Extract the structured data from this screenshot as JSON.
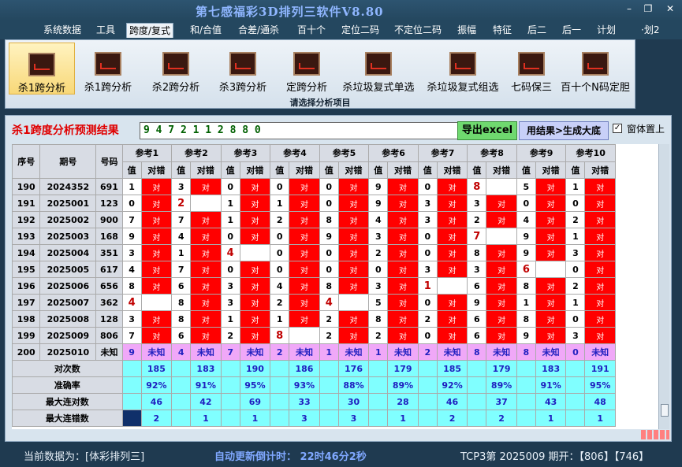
{
  "app": {
    "title": "第七感福彩3D排列三软件V8.80",
    "min_btn": "–",
    "max_btn": "❐",
    "close_btn": "✕"
  },
  "menu": [
    {
      "label": "系统数据"
    },
    {
      "label": "工具"
    },
    {
      "label": "跨度/复式",
      "active": true
    },
    {
      "label": "和/合值"
    },
    {
      "label": "合差/通杀"
    },
    {
      "label": "百十个"
    },
    {
      "label": "定位二码"
    },
    {
      "label": "不定位二码"
    },
    {
      "label": "振幅"
    },
    {
      "label": "特征"
    },
    {
      "label": "后二"
    },
    {
      "label": "后一"
    },
    {
      "label": "计划"
    },
    {
      "label": "·划2"
    }
  ],
  "ribbon": {
    "buttons": [
      {
        "label": "杀1跨分析",
        "selected": true,
        "icon": "analysis-chart-icon"
      },
      {
        "label": "杀1跨分析",
        "icon": "analysis-chart-icon"
      },
      {
        "label": "杀2跨分析",
        "icon": "analysis-chart-icon"
      },
      {
        "label": "杀3跨分析",
        "icon": "analysis-chart-icon"
      },
      {
        "label": "定跨分析",
        "icon": "analysis-chart-icon"
      },
      {
        "label": "杀垃圾复式单选",
        "icon": "analysis-chart-icon"
      },
      {
        "label": "杀垃圾复式组选",
        "icon": "analysis-chart-icon"
      },
      {
        "label": "七码保三",
        "icon": "analysis-chart-icon"
      },
      {
        "label": "百十个N码定胆",
        "icon": "analysis-chart-icon"
      }
    ],
    "caption": "请选择分析项目"
  },
  "result": {
    "title": "杀1跨度分析预测结果",
    "value": "9 4 7 2 1 1 2 8 8 0",
    "export_label": "导出excel",
    "generate_label": "用结果>生成大底",
    "ontop_label": "窗体置上",
    "ontop_checked": "✓"
  },
  "table": {
    "headers": {
      "seq": "序号",
      "issue": "期号",
      "code": "号码",
      "val": "值",
      "ok": "对错"
    },
    "refs": [
      "参考1",
      "参考2",
      "参考3",
      "参考4",
      "参考5",
      "参考6",
      "参考7",
      "参考8",
      "参考9",
      "参考10"
    ],
    "right_mark": "对",
    "unknown": "未知",
    "rows": [
      {
        "seq": "190",
        "issue": "2024352",
        "code": "691",
        "cells": [
          [
            "1",
            1
          ],
          [
            "3",
            1
          ],
          [
            "0",
            1
          ],
          [
            "0",
            1
          ],
          [
            "0",
            1
          ],
          [
            "9",
            1
          ],
          [
            "0",
            1
          ],
          [
            "8",
            0
          ],
          [
            "5",
            1
          ],
          [
            "1",
            1
          ]
        ]
      },
      {
        "seq": "191",
        "issue": "2025001",
        "code": "123",
        "cells": [
          [
            "0",
            1
          ],
          [
            "2",
            0
          ],
          [
            "1",
            1
          ],
          [
            "1",
            1
          ],
          [
            "0",
            1
          ],
          [
            "9",
            1
          ],
          [
            "3",
            1
          ],
          [
            "3",
            1
          ],
          [
            "0",
            1
          ],
          [
            "0",
            1
          ]
        ]
      },
      {
        "seq": "192",
        "issue": "2025002",
        "code": "900",
        "cells": [
          [
            "7",
            1
          ],
          [
            "7",
            1
          ],
          [
            "1",
            1
          ],
          [
            "2",
            1
          ],
          [
            "8",
            1
          ],
          [
            "4",
            1
          ],
          [
            "3",
            1
          ],
          [
            "2",
            1
          ],
          [
            "4",
            1
          ],
          [
            "2",
            1
          ]
        ]
      },
      {
        "seq": "193",
        "issue": "2025003",
        "code": "168",
        "cells": [
          [
            "9",
            1
          ],
          [
            "4",
            1
          ],
          [
            "0",
            1
          ],
          [
            "0",
            1
          ],
          [
            "9",
            1
          ],
          [
            "3",
            1
          ],
          [
            "0",
            1
          ],
          [
            "7",
            0
          ],
          [
            "9",
            1
          ],
          [
            "1",
            1
          ]
        ]
      },
      {
        "seq": "194",
        "issue": "2025004",
        "code": "351",
        "cells": [
          [
            "3",
            1
          ],
          [
            "1",
            1
          ],
          [
            "4",
            0
          ],
          [
            "0",
            1
          ],
          [
            "0",
            1
          ],
          [
            "2",
            1
          ],
          [
            "0",
            1
          ],
          [
            "8",
            1
          ],
          [
            "9",
            1
          ],
          [
            "3",
            1
          ]
        ]
      },
      {
        "seq": "195",
        "issue": "2025005",
        "code": "617",
        "cells": [
          [
            "4",
            1
          ],
          [
            "7",
            1
          ],
          [
            "0",
            1
          ],
          [
            "0",
            1
          ],
          [
            "0",
            1
          ],
          [
            "0",
            1
          ],
          [
            "3",
            1
          ],
          [
            "3",
            1
          ],
          [
            "6",
            0
          ],
          [
            "0",
            1
          ]
        ]
      },
      {
        "seq": "196",
        "issue": "2025006",
        "code": "656",
        "cells": [
          [
            "8",
            1
          ],
          [
            "6",
            1
          ],
          [
            "3",
            1
          ],
          [
            "4",
            1
          ],
          [
            "8",
            1
          ],
          [
            "3",
            1
          ],
          [
            "1",
            0
          ],
          [
            "6",
            1
          ],
          [
            "8",
            1
          ],
          [
            "2",
            1
          ]
        ]
      },
      {
        "seq": "197",
        "issue": "2025007",
        "code": "362",
        "cells": [
          [
            "4",
            0
          ],
          [
            "8",
            1
          ],
          [
            "3",
            1
          ],
          [
            "2",
            1
          ],
          [
            "4",
            0
          ],
          [
            "5",
            1
          ],
          [
            "0",
            1
          ],
          [
            "9",
            1
          ],
          [
            "1",
            1
          ],
          [
            "1",
            1
          ]
        ]
      },
      {
        "seq": "198",
        "issue": "2025008",
        "code": "128",
        "cells": [
          [
            "3",
            1
          ],
          [
            "8",
            1
          ],
          [
            "1",
            1
          ],
          [
            "1",
            1
          ],
          [
            "2",
            1
          ],
          [
            "8",
            1
          ],
          [
            "2",
            1
          ],
          [
            "6",
            1
          ],
          [
            "8",
            1
          ],
          [
            "0",
            1
          ]
        ]
      },
      {
        "seq": "199",
        "issue": "2025009",
        "code": "806",
        "cells": [
          [
            "7",
            1
          ],
          [
            "6",
            1
          ],
          [
            "2",
            1
          ],
          [
            "8",
            0
          ],
          [
            "2",
            1
          ],
          [
            "2",
            1
          ],
          [
            "0",
            1
          ],
          [
            "6",
            1
          ],
          [
            "9",
            1
          ],
          [
            "3",
            1
          ]
        ]
      }
    ],
    "predict": {
      "seq": "200",
      "issue": "2025010",
      "code": "未知",
      "vals": [
        "9",
        "4",
        "7",
        "2",
        "1",
        "1",
        "2",
        "8",
        "8",
        "0"
      ]
    },
    "stats": [
      {
        "label": "对次数",
        "vals": [
          "185",
          "183",
          "190",
          "186",
          "176",
          "179",
          "185",
          "179",
          "183",
          "191"
        ]
      },
      {
        "label": "准确率",
        "vals": [
          "92%",
          "91%",
          "95%",
          "93%",
          "88%",
          "89%",
          "92%",
          "89%",
          "91%",
          "95%"
        ]
      },
      {
        "label": "最大连对数",
        "vals": [
          "46",
          "42",
          "69",
          "33",
          "30",
          "28",
          "46",
          "37",
          "43",
          "48"
        ]
      },
      {
        "label": "最大连错数",
        "vals": [
          "2",
          "1",
          "1",
          "3",
          "3",
          "1",
          "2",
          "2",
          "1",
          "1"
        ]
      }
    ]
  },
  "status": {
    "current": "当前数据为：[体彩排列三]",
    "countdown": "自动更新倒计时：  22时46分2秒",
    "draw": "TCP3第 2025009 期开：【806】【746】"
  }
}
